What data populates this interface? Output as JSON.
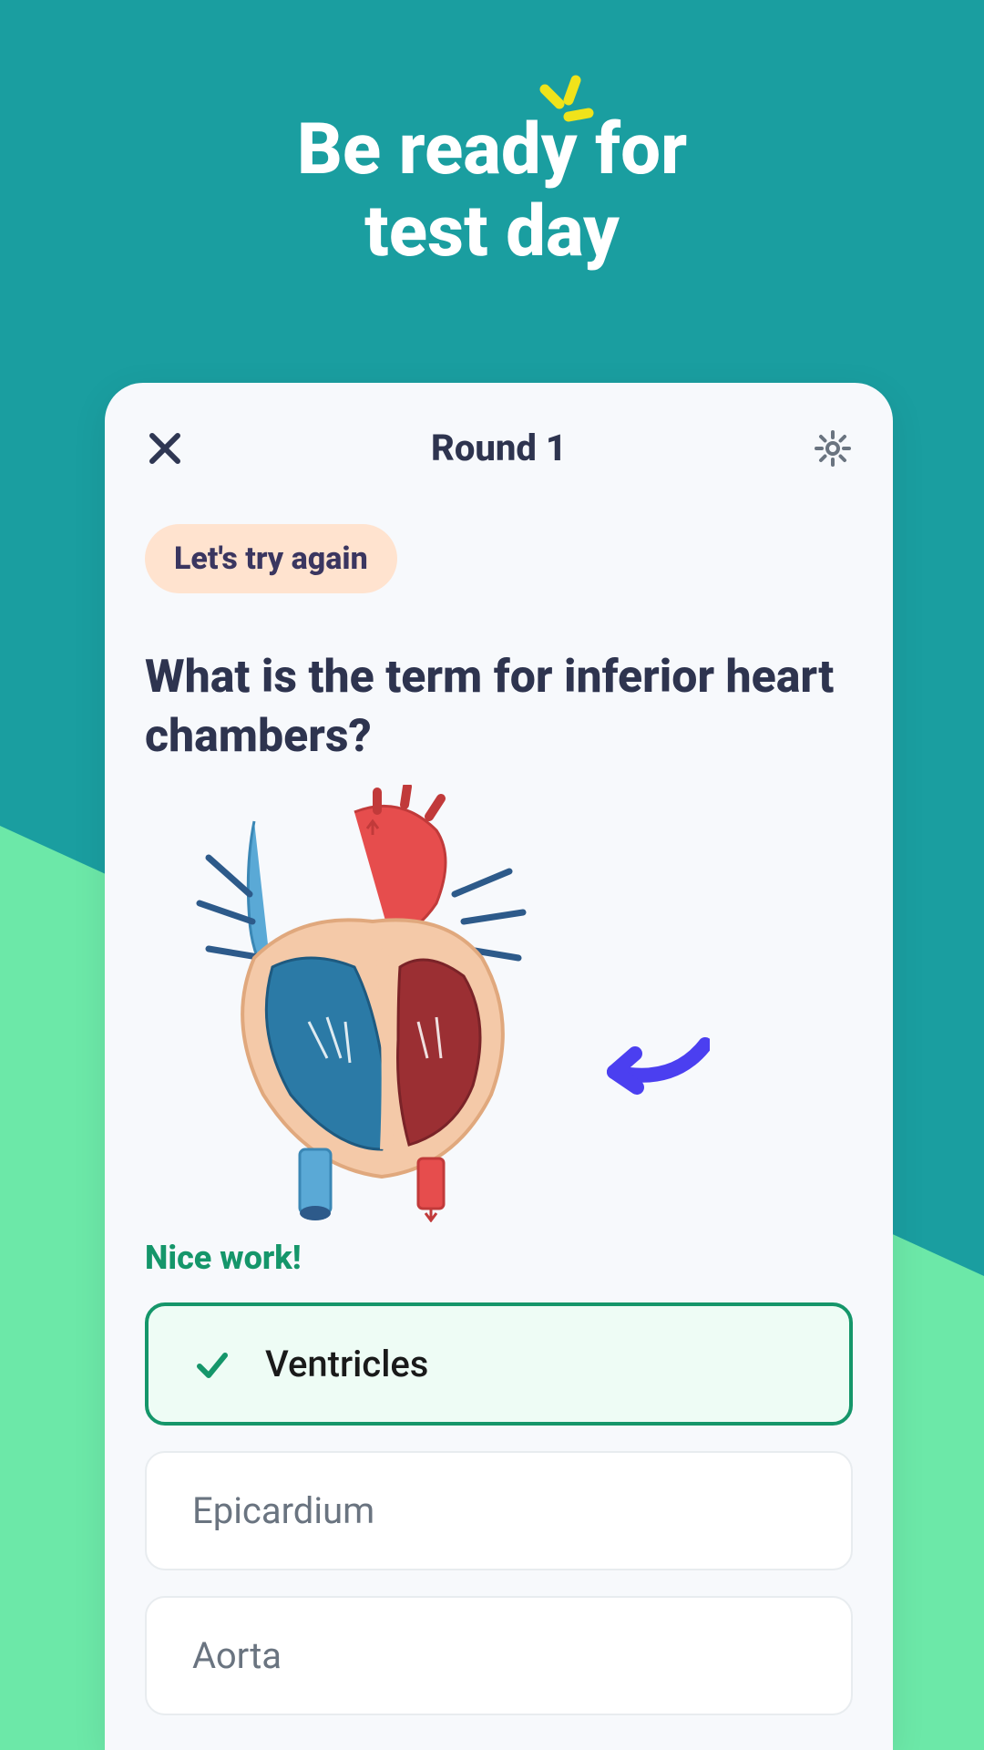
{
  "headline": {
    "line1": "Be ready for",
    "line2": "test day"
  },
  "card": {
    "round_label": "Round 1",
    "hint_pill": "Let's try again",
    "question": "What is the term for inferior heart chambers?",
    "feedback": "Nice work!",
    "options": [
      {
        "label": "Ventricles",
        "correct": true
      },
      {
        "label": "Epicardium",
        "correct": false
      },
      {
        "label": "Aorta",
        "correct": false
      }
    ]
  },
  "colors": {
    "teal": "#1a9ea0",
    "green": "#6ce8a8",
    "accent_yellow": "#f0e31a",
    "correct_green": "#15966a",
    "arrow_blue": "#4b3ff0"
  }
}
